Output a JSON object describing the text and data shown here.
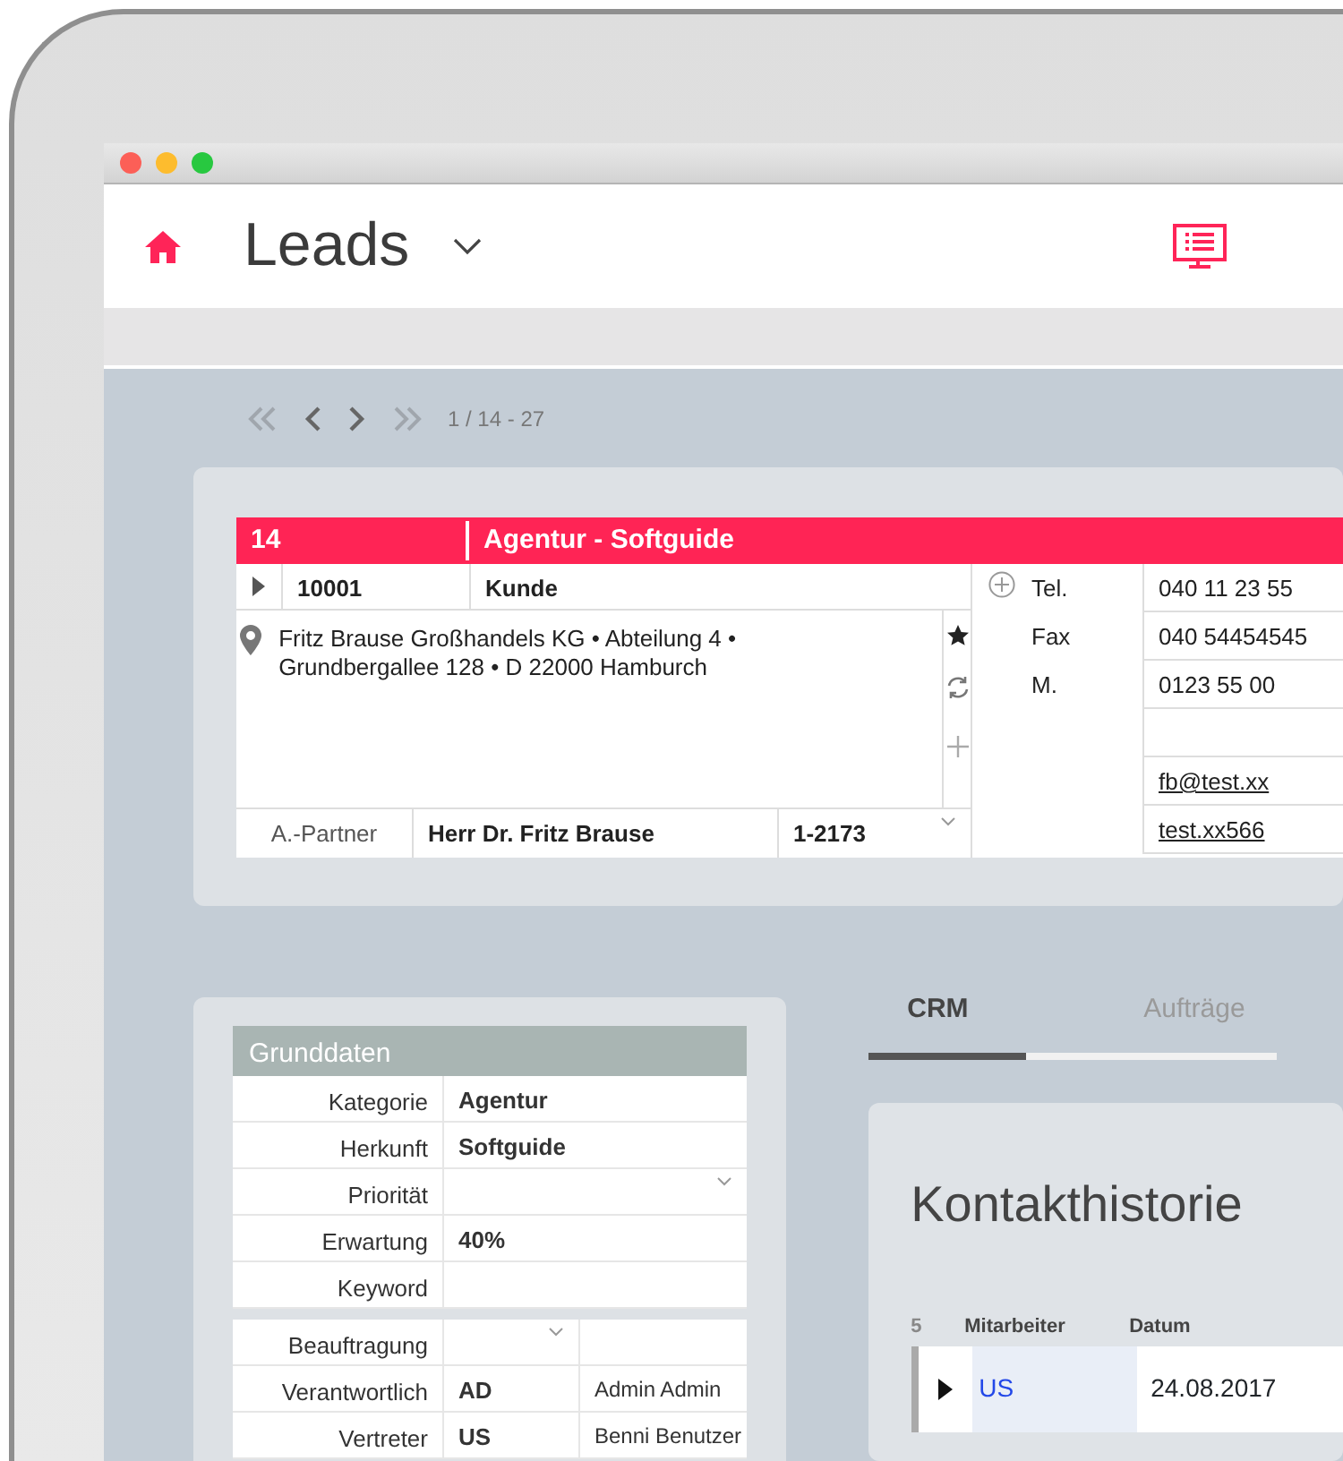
{
  "header": {
    "title": "Leads"
  },
  "pager": {
    "text": "1 / 14 - 27"
  },
  "record": {
    "number": "14",
    "title": "Agentur - Softguide",
    "id": "10001",
    "type": "Kunde",
    "address": "Fritz Brause Großhandels KG • Abteilung 4 • Grundbergallee 128 • D 22000 Hamburch",
    "contact_label": "A.-Partner",
    "contact_name": "Herr Dr. Fritz Brause",
    "contact_number": "1-2173",
    "contacts": [
      {
        "label": "Tel.",
        "value": "040 11 23 55",
        "kind": "text"
      },
      {
        "label": "Fax",
        "value": "040 54454545",
        "kind": "text"
      },
      {
        "label": "M.",
        "value": "0123 55 00",
        "kind": "text"
      },
      {
        "kind": "text"
      },
      {
        "value": "fb@test.xx",
        "kind": "link"
      },
      {
        "value": "test.xx566",
        "kind": "link"
      }
    ]
  },
  "grunddaten": {
    "title": "Grunddaten",
    "fields": [
      {
        "label": "Kategorie",
        "value": "Agentur",
        "dropdown": false
      },
      {
        "label": "Herkunft",
        "value": "Softguide",
        "dropdown": false
      },
      {
        "label": "Priorität",
        "dropdown": true
      },
      {
        "label": "Erwartung",
        "value": "40%",
        "dropdown": false
      },
      {
        "label": "Keyword",
        "dropdown": false
      }
    ],
    "assignments": [
      {
        "label": "Beauftragung",
        "dropdown": true
      },
      {
        "label": "Verantwortlich",
        "code": "AD",
        "name": "Admin Admin",
        "dropdown": false
      },
      {
        "label": "Vertreter",
        "code": "US",
        "name": "Benni Benutzer",
        "dropdown": false
      }
    ]
  },
  "tabs": [
    {
      "label": "CRM",
      "selected": true
    },
    {
      "label": "Aufträge",
      "selected": false
    }
  ],
  "history": {
    "title": "Kontakthistorie",
    "count": "5",
    "columns": [
      "Mitarbeiter",
      "Datum"
    ],
    "rows": [
      {
        "employee": "US",
        "date": "24.08.2017"
      }
    ]
  }
}
